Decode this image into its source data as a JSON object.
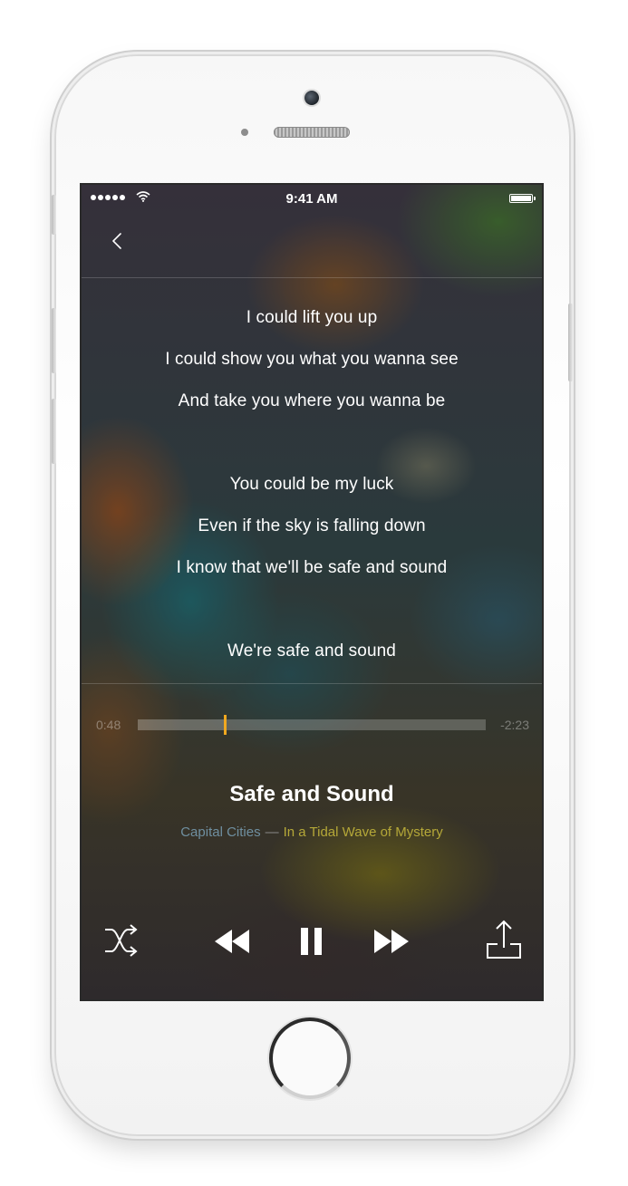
{
  "status_bar": {
    "time": "9:41 AM",
    "signal_dots": 5
  },
  "lyrics": {
    "blocks": [
      [
        "I could lift you up",
        "I could show you what you wanna see",
        "And take you where you wanna be"
      ],
      [
        "You could be my luck",
        "Even if the sky is falling down",
        "I know that we'll be safe and sound"
      ],
      [
        "We're safe and sound"
      ]
    ]
  },
  "player": {
    "elapsed": "0:48",
    "remaining": "-2:23",
    "progress": 0.25,
    "accent_color": "#f0a820"
  },
  "song": {
    "title": "Safe and Sound",
    "artist": "Capital Cities",
    "separator": "—",
    "album": "In a Tidal Wave of Mystery",
    "artist_color": "#6f8fa0",
    "album_color": "#b5a838"
  },
  "icons": {
    "back": "chevron-left-icon",
    "shuffle": "shuffle-icon",
    "rewind": "rewind-icon",
    "pause": "pause-icon",
    "fast_forward": "fast-forward-icon",
    "share": "share-icon"
  }
}
